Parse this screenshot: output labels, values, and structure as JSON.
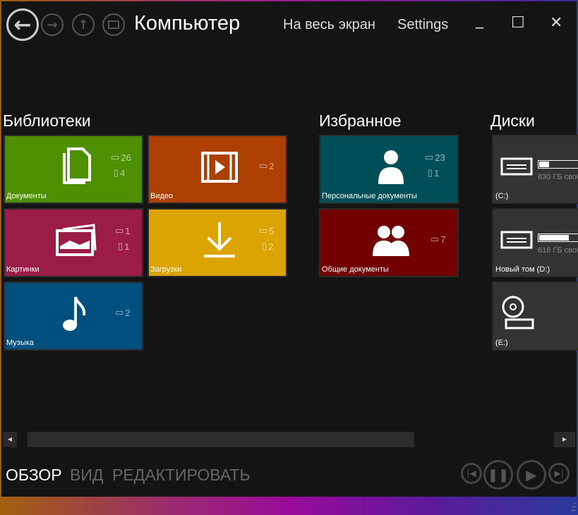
{
  "window": {
    "title": "Компьютер",
    "fullscreen": "На весь экран",
    "settings": "Settings",
    "minimize": "_",
    "maximize": "☐",
    "close": "✕"
  },
  "sections": {
    "libraries": "Библиотеки",
    "favorites": "Избранное",
    "disks": "Диски"
  },
  "libraries": [
    {
      "label": "Документы",
      "folders": "26",
      "files": "4",
      "color": "#4e8f00"
    },
    {
      "label": "Видео",
      "folders": "2",
      "color": "#ad3f00"
    },
    {
      "label": "Картинки",
      "folders": "1",
      "files": "1",
      "color": "#9b1c47"
    },
    {
      "label": "Загрузки",
      "folders": "5",
      "files": "2",
      "color": "#dca400"
    },
    {
      "label": "Музыка",
      "folders": "2",
      "color": "#00507f"
    }
  ],
  "favorites": [
    {
      "label": "Персональные документы",
      "folders": "23",
      "files": "1",
      "color": "#004e57"
    },
    {
      "label": "Общие документы",
      "folders": "7",
      "color": "#720000"
    }
  ],
  "disks": [
    {
      "label": "(C:)",
      "free": "830 ГБ своб",
      "used_fraction": 0.2
    },
    {
      "label": "Новый том (D:)",
      "free": "618 ГБ своб",
      "used_fraction": 0.62
    },
    {
      "label": "(E:)"
    }
  ],
  "bottom": {
    "overview": "ОБЗОР",
    "view": "ВИД",
    "edit": "РЕДАКТИРОВАТЬ"
  }
}
